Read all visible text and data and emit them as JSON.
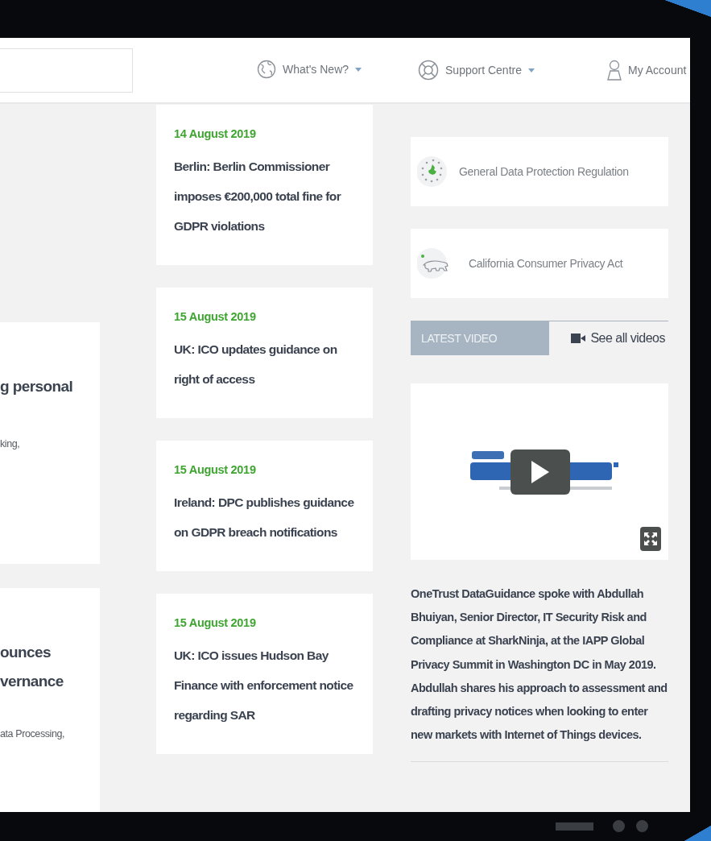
{
  "nav": [
    {
      "kind": "globe",
      "label": "What's New?"
    },
    {
      "kind": "lifebuoy",
      "label": "Support Centre"
    },
    {
      "kind": "person",
      "label": "My Account"
    }
  ],
  "left_cards": [
    {
      "title_lines": [
        "g personal"
      ],
      "tags": "king,"
    },
    {
      "title_lines": [
        "ounces",
        "vernance"
      ],
      "tags": "ata Processing,"
    }
  ],
  "news": [
    {
      "date": "14 August 2019",
      "title": "Berlin: Berlin Commissioner imposes €200,000 total fine for GDPR violations"
    },
    {
      "date": "15 August 2019",
      "title": "UK: ICO updates guidance on right of access"
    },
    {
      "date": "15 August 2019",
      "title": "Ireland: DPC publishes guidance on GDPR breach notifications"
    },
    {
      "date": "15 August 2019",
      "title": "UK: ICO issues Hudson Bay Finance with enforcement notice regarding SAR"
    }
  ],
  "regulations": [
    {
      "kind": "eu",
      "label": "General Data Protection Regulation"
    },
    {
      "kind": "bear",
      "label": "California Consumer Privacy Act"
    }
  ],
  "video": {
    "tab": "LATEST VIDEO",
    "link": "See all videos",
    "description": "OneTrust DataGuidance spoke with Abdullah Bhuiyan, Senior Director, IT Security Risk and Compliance at SharkNinja, at the IAPP Global Privacy Summit in Washington DC in May 2019. Abdullah shares his approach to assessment and drafting privacy notices when looking to enter new markets with Internet of Things devices."
  }
}
